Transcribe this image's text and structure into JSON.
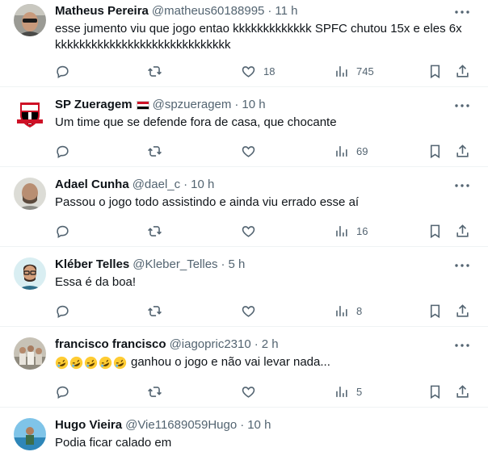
{
  "tweets": [
    {
      "name": "Matheus Pereira",
      "handle": "@matheus60188995",
      "separator": "·",
      "time": "11 h",
      "text": "esse jumento viu que jogo entao kkkkkkkkkkkkk SPFC chutou 15x e eles 6x kkkkkkkkkkkkkkkkkkkkkkkkkkkkk",
      "likes": "18",
      "views": "745",
      "avatar": "avatar-photo-man-sunglasses"
    },
    {
      "name": "SP Zueragem",
      "handle": "@spzueragem",
      "separator": "·",
      "time": "10 h",
      "text": "Um time que se defende fora de casa, que chocante",
      "likes": "",
      "views": "69",
      "avatar": "spfc-crest-logo",
      "has_flag": true
    },
    {
      "name": "Adael Cunha",
      "handle": "@dael_c",
      "separator": "·",
      "time": "10 h",
      "text": "Passou o jogo todo assistindo e ainda viu errado esse aí",
      "likes": "",
      "views": "16",
      "avatar": "avatar-photo-man-beard"
    },
    {
      "name": "Kléber Telles",
      "handle": "@Kleber_Telles",
      "separator": "·",
      "time": "5 h",
      "text": "Essa é da boa!",
      "likes": "",
      "views": "8",
      "avatar": "avatar-illustration-man-glasses"
    },
    {
      "name": "francisco francisco",
      "handle": "@iagopric2310",
      "separator": "·",
      "time": "2 h",
      "text": "ganhou o jogo e não vai levar nada...",
      "emoji_prefix": "🤣🤣🤣🤣🤣",
      "likes": "",
      "views": "5",
      "avatar": "avatar-photo-group"
    },
    {
      "name": "Hugo Vieira",
      "handle": "@Vie11689059Hugo",
      "separator": "·",
      "time": "10 h",
      "text": "Podia ficar calado em",
      "avatar": "avatar-photo-beach"
    }
  ],
  "colors": {
    "text_primary": "#0f1419",
    "text_secondary": "#536471",
    "divider": "#eff3f4"
  },
  "icons": {
    "reply": "reply-icon",
    "repost": "repost-icon",
    "like": "like-icon",
    "views": "views-icon",
    "bookmark": "bookmark-icon",
    "share": "share-icon",
    "more": "more-icon"
  }
}
